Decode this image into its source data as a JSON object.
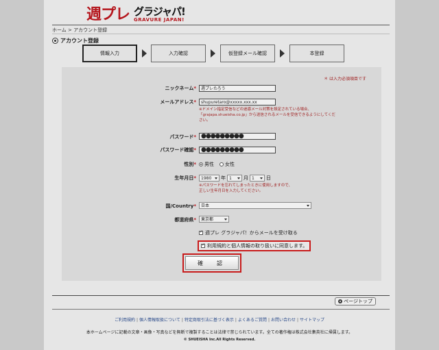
{
  "header": {
    "logo_main": "週プレ",
    "logo_sub_top": "グラジャパ!",
    "logo_sub_bottom": "GRAVURE JAPAN!"
  },
  "breadcrumb": "ホーム > アカウント登録",
  "section_title": "アカウント登録",
  "steps": [
    {
      "label": "情報入力",
      "active": true
    },
    {
      "label": "入力確認",
      "active": false
    },
    {
      "label": "仮登録メール確認",
      "active": false
    },
    {
      "label": "本登録",
      "active": false
    }
  ],
  "form": {
    "required_note": "＊ は入力必須項目です",
    "nickname": {
      "label": "ニックネーム",
      "value": "週プレたろう"
    },
    "email": {
      "label": "メールアドレス",
      "value": "shupuretaro@xxxxx.xxx.xx",
      "note_line1": "※ドメイン指定受信などの迷惑メール対策を設定されている場合、",
      "note_line2": "「grajapa.shueisha.co.jp」から送信されるメールを受信できるようにしてくだ",
      "note_line3": "さい。"
    },
    "password": {
      "label": "パスワード",
      "value": "●●●●●●●●●"
    },
    "password_confirm": {
      "label": "パスワード確認",
      "value": "●●●●●●●●●"
    },
    "gender": {
      "label": "性別",
      "male": "男性",
      "female": "女性"
    },
    "birthday": {
      "label": "生年月日",
      "year": "1980",
      "year_unit": "年",
      "month": "1",
      "month_unit": "月",
      "day": "1",
      "day_unit": "日",
      "note_line1": "※パスワードを忘れてしまったときに使用しますので、",
      "note_line2": "正しい生年月日を入力してください。"
    },
    "country": {
      "label": "国/Country",
      "value": "日本"
    },
    "prefecture": {
      "label": "都道府県",
      "value": "東京都"
    },
    "mail_optin": "週プレ グラジャパ！からメールを受け取る",
    "agree": "利用規約と個人情報の取り扱いに同意します。",
    "confirm_button": "確　認",
    "star": "*"
  },
  "footer": {
    "pagetop": "ページトップ",
    "links": [
      "ご利用規約",
      "個人情報取扱について",
      "特定商取引法に基づく表示",
      "よくあるご質問",
      "お問い合わせ",
      "サイトマップ"
    ],
    "note": "本ホームページに記載の文章・画像・写真などを無断で複製することは法律で禁じられています。全ての著作権は株式会社集英社に帰属します。",
    "copyright": "© SHUEISHA Inc.All Rights Reserved."
  },
  "colors": {
    "accent_red": "#c81a1a",
    "link_blue": "#2a4a8a"
  }
}
